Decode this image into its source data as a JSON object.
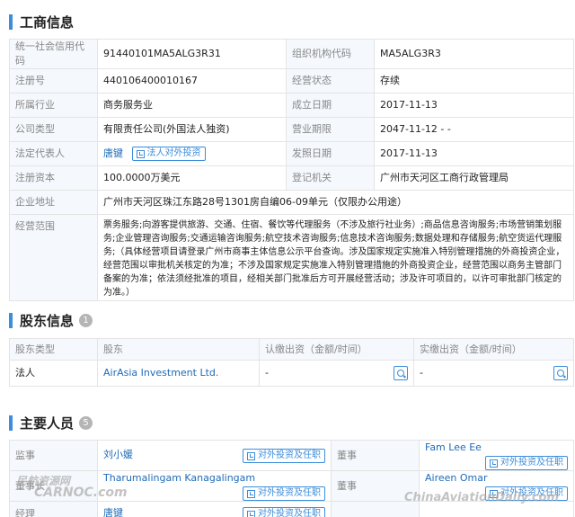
{
  "business_info": {
    "title": "工商信息",
    "rows": [
      {
        "l1": "统一社会信用代码",
        "v1": "91440101MA5ALG3R31",
        "l2": "组织机构代码",
        "v2": "MA5ALG3R3"
      },
      {
        "l1": "注册号",
        "v1": "440106400010167",
        "l2": "经营状态",
        "v2": "存续"
      },
      {
        "l1": "所属行业",
        "v1": "商务服务业",
        "l2": "成立日期",
        "v2": "2017-11-13"
      },
      {
        "l1": "公司类型",
        "v1": "有限责任公司(外国法人独资)",
        "l2": "营业期限",
        "v2": "2047-11-12 - -"
      },
      {
        "l1": "法定代表人",
        "v1": "唐键",
        "l2": "发照日期",
        "v2": "2017-11-13"
      },
      {
        "l1": "注册资本",
        "v1": "100.0000万美元",
        "l2": "登记机关",
        "v2": "广州市天河区工商行政管理局"
      }
    ],
    "legal_rep_button": "法人对外投资",
    "address_label": "企业地址",
    "address": "广州市天河区珠江东路28号1301房自编06-09单元（仅限办公用途）",
    "scope_label": "经营范围",
    "scope": "票务服务;向游客提供旅游、交通、住宿、餐饮等代理服务（不涉及旅行社业务）;商品信息咨询服务;市场营销策划服务;企业管理咨询服务;交通运输咨询服务;航空技术咨询服务;信息技术咨询服务;数据处理和存储服务;航空货运代理服务;（具体经营项目请登录广州市商事主体信息公示平台查询。涉及国家规定实施准入特别管理措施的外商投资企业，经营范围以审批机关核定的为准；不涉及国家规定实施准入特别管理措施的外商投资企业，经营范围以商务主管部门备案的为准；依法须经批准的项目，经相关部门批准后方可开展经营活动；涉及许可项目的，以许可审批部门核定的为准。）"
  },
  "shareholders": {
    "title": "股东信息",
    "count": "1",
    "headers": [
      "股东类型",
      "股东",
      "认缴出资（金额/时间）",
      "实缴出资（金额/时间）"
    ],
    "rows": [
      {
        "type": "法人",
        "name": "AirAsia Investment Ltd.",
        "subscribed": "-",
        "paid": "-"
      }
    ]
  },
  "key_personnel": {
    "title": "主要人员",
    "count": "5",
    "button_label": "对外投资及任职",
    "rows": [
      {
        "role1": "监事",
        "name1": "刘小媛",
        "role2": "董事",
        "name2": "Fam Lee Ee"
      },
      {
        "role1": "董事长",
        "name1": "Tharumalingam Kanagalingam",
        "role2": "董事",
        "name2": "Aireen Omar"
      },
      {
        "role1": "经理",
        "name1": "唐键",
        "role2": "",
        "name2": ""
      }
    ]
  },
  "watermarks": {
    "left_cn": "民航资源网",
    "left_en": "CARNOC.com",
    "right": "ChinaAviationDaily.com"
  }
}
